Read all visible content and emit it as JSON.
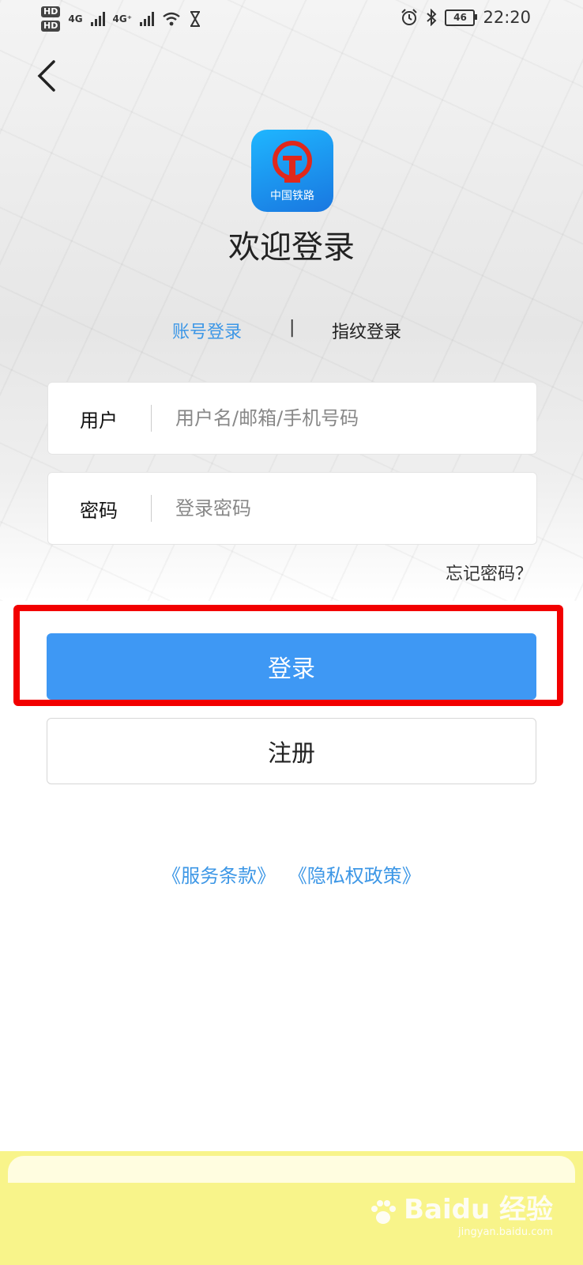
{
  "status_bar": {
    "hd1": "HD",
    "hd2": "HD",
    "net1": "4G",
    "net2": "4G⁺",
    "battery": "46",
    "time": "22:20"
  },
  "logo": {
    "text": "中国铁路"
  },
  "title": "欢迎登录",
  "tabs": {
    "account": "账号登录",
    "separator": "|",
    "fingerprint": "指纹登录"
  },
  "form": {
    "user_label": "用户",
    "user_placeholder": "用户名/邮箱/手机号码",
    "password_label": "密码",
    "password_placeholder": "登录密码"
  },
  "forgot_password": "忘记密码？",
  "buttons": {
    "login": "登录",
    "register": "注册"
  },
  "links": {
    "terms": "《服务条款》",
    "privacy": "《隐私权政策》"
  },
  "watermark": {
    "brand": "Baidu",
    "text": "经验",
    "url": "jingyan.baidu.com"
  },
  "colors": {
    "accent": "#3e98f4",
    "link": "#3d97e6",
    "highlight": "#f20000"
  }
}
